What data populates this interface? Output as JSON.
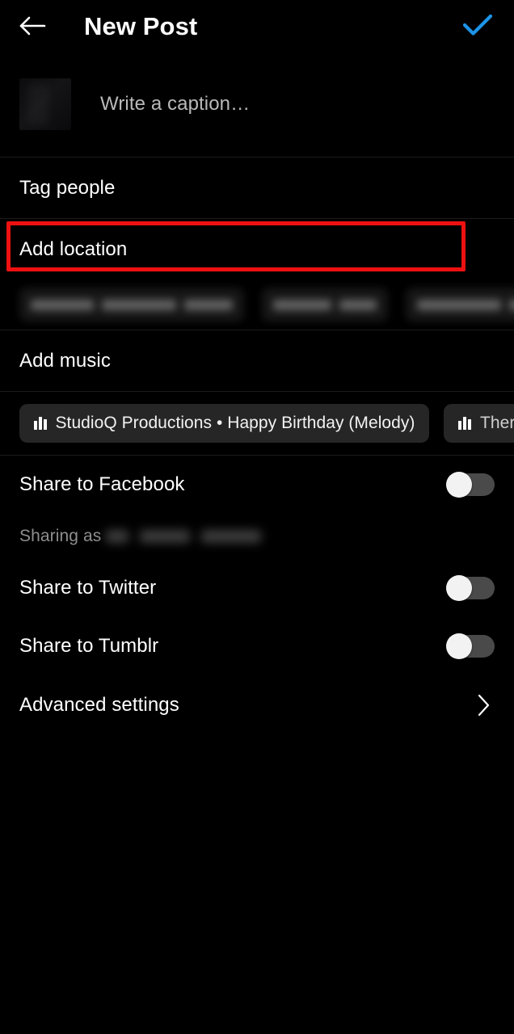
{
  "header": {
    "back_icon": "arrow-left-icon",
    "title": "New Post",
    "confirm_icon": "check-icon",
    "confirm_color": "#1c94e8"
  },
  "caption": {
    "placeholder": "Write a caption…",
    "value": "",
    "thumbnail": "post-thumbnail"
  },
  "rows": {
    "tag_people": "Tag people",
    "add_location": "Add location",
    "add_music": "Add music",
    "advanced_settings": "Advanced settings",
    "chevron_icon": "chevron-right-icon"
  },
  "location_suggestions": [
    {
      "redacted": true,
      "blocks": [
        78,
        92,
        60
      ]
    },
    {
      "redacted": true,
      "blocks": [
        72,
        46
      ]
    },
    {
      "redacted": true,
      "blocks": [
        104,
        66
      ]
    }
  ],
  "music_suggestions": [
    {
      "icon": "music-equalizer-icon",
      "label": "StudioQ Productions • Happy Birthday (Melody)",
      "selected": false
    },
    {
      "icon": "music-equalizer-icon",
      "label": "Ther",
      "selected": false
    }
  ],
  "share_toggles": [
    {
      "label": "Share to Facebook",
      "state": "off"
    },
    {
      "label": "Share to Twitter",
      "state": "off"
    },
    {
      "label": "Share to Tumblr",
      "state": "off"
    }
  ],
  "sharing_as": {
    "prefix": "Sharing as",
    "account_redacted": true,
    "blocks": [
      28,
      62,
      74
    ]
  },
  "annotation": {
    "target": "Add location",
    "color": "#ee1111",
    "shape": "rectangle"
  },
  "colors": {
    "background": "#000000",
    "divider": "#1c1c1c",
    "accent_blue": "#1c94e8",
    "chip_background": "#262626",
    "muted_text": "#8e8e8e",
    "placeholder_text": "#b9b9b9",
    "switch_track_off": "#4a4a4a",
    "switch_knob": "#f2f2f2"
  }
}
